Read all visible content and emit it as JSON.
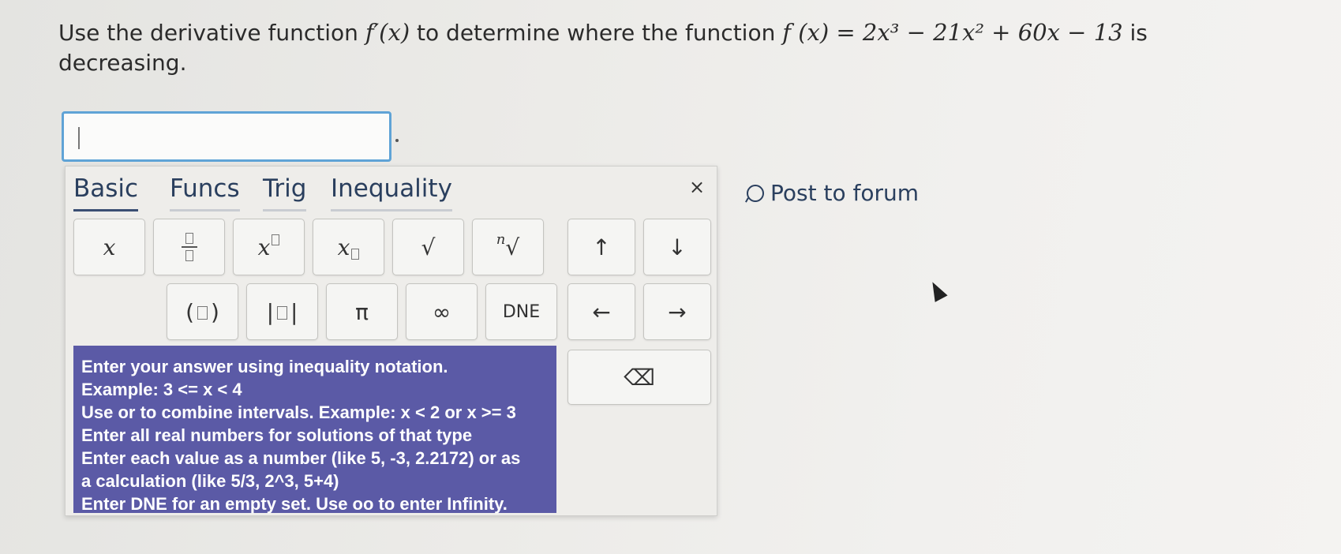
{
  "question": {
    "prefix": "Use the derivative function",
    "derivative": "f′(x)",
    "middle": "to determine where the function",
    "function": "f (x) = 2x³ − 21x² + 60x − 13",
    "suffix": "is decreasing."
  },
  "answer": {
    "value": ""
  },
  "palette": {
    "tabs": [
      "Basic",
      "Funcs",
      "Trig",
      "Inequality"
    ],
    "close": "×",
    "keys": {
      "x": "x",
      "pi": "π",
      "infinity": "∞",
      "dne": "DNE",
      "up": "↑",
      "down": "↓",
      "left": "←",
      "right": "→",
      "sqrt": "√",
      "nroot_index": "n",
      "backspace": "⌫"
    },
    "help": [
      "Enter your answer using inequality notation.",
      "Example: 3 <= x < 4",
      "Use or to combine intervals. Example: x < 2 or x >= 3",
      "Enter all real numbers for solutions of that type",
      "Enter each value as a number (like 5, -3, 2.2172) or as",
      "a calculation (like 5/3, 2^3, 5+4)",
      "Enter DNE for an empty set. Use oo to enter Infinity."
    ]
  },
  "forum": {
    "label": "Post to forum"
  }
}
